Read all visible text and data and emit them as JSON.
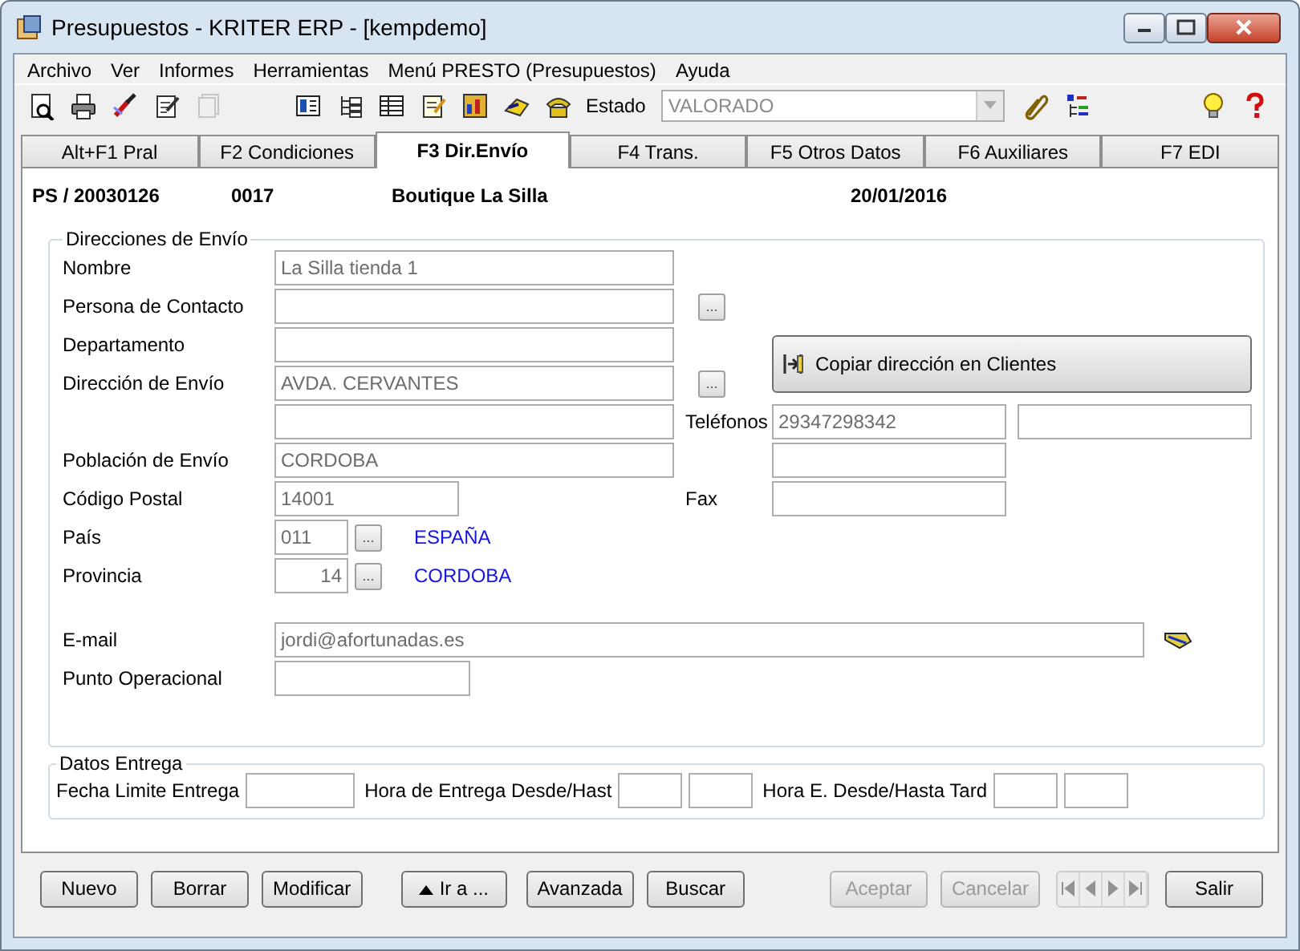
{
  "window": {
    "title": "Presupuestos - KRITER ERP - [kempdemo]"
  },
  "menu": [
    {
      "label": "Archivo"
    },
    {
      "label": "Ver"
    },
    {
      "label": "Informes"
    },
    {
      "label": "Herramientas"
    },
    {
      "label": "Menú PRESTO (Presupuestos)"
    },
    {
      "label": "Ayuda"
    }
  ],
  "toolbar": {
    "tools": [
      {
        "disabled": false
      },
      {
        "disabled": false
      },
      {
        "disabled": false
      },
      {
        "disabled": false
      },
      {
        "disabled": true
      },
      {
        "disabled": false
      },
      {
        "disabled": false
      },
      {
        "disabled": false
      },
      {
        "disabled": false
      },
      {
        "disabled": false
      },
      {
        "disabled": false
      },
      {
        "disabled": false
      }
    ],
    "estado_label": "Estado",
    "estado": {
      "value": "VALORADO",
      "disabled": true
    },
    "tools_after": [
      {
        "disabled": false
      },
      {
        "disabled": false
      },
      {
        "disabled": false
      },
      {
        "disabled": false
      }
    ]
  },
  "tabs": [
    {
      "label": "Alt+F1 Pral",
      "selected": false
    },
    {
      "label": "F2 Condiciones",
      "selected": false
    },
    {
      "label": "F3 Dir.Envío",
      "selected": true
    },
    {
      "label": "F4 Trans.",
      "selected": false
    },
    {
      "label": "F5 Otros Datos",
      "selected": false
    },
    {
      "label": "F6 Auxiliares",
      "selected": false
    },
    {
      "label": "F7 EDI",
      "selected": false
    }
  ],
  "header": {
    "document": "PS / 20030126",
    "code": "0017",
    "customer": "Boutique La Silla",
    "date": "20/01/2016"
  },
  "shipping": {
    "title": "Direcciones de Envío",
    "fields": [
      {
        "kind": "text",
        "label": "Nombre",
        "value": "La Silla tienda 1"
      },
      {
        "kind": "text",
        "label": "Persona de Contacto",
        "lookup": "..."
      },
      {
        "kind": "text",
        "label": "Departamento"
      },
      {
        "kind": "text",
        "label": "Dirección de Envío",
        "value": "AVDA. CERVANTES",
        "lookup": "..."
      },
      {
        "kind": "text"
      },
      {
        "kind": "text",
        "label": "Población de Envío",
        "value": "CORDOBA"
      },
      {
        "kind": "short",
        "label": "Código Postal",
        "value": "14001"
      },
      {
        "kind": "code",
        "label": "País",
        "value": "011",
        "lookup": "...",
        "lookup_name": "ESPAÑA"
      },
      {
        "kind": "number",
        "label": "Provincia",
        "value": "14",
        "lookup": "...",
        "lookup_name": "CORDOBA"
      }
    ],
    "copy_button": "Copiar dirección en Clientes",
    "phones_label": "Teléfonos",
    "phones": [
      {
        "kind": "phone",
        "value": "29347298342"
      },
      {
        "kind": "phone"
      },
      {
        "kind": "phone"
      }
    ],
    "fax_label": "Fax",
    "email": {
      "label": "E-mail",
      "value": "jordi@afortunadas.es"
    },
    "operational_point": {
      "label": "Punto Operacional"
    }
  },
  "delivery": {
    "title": "Datos Entrega",
    "items": [
      {
        "label": "Fecha Limite Entrega",
        "fields": [
          {
            "kind": "date"
          }
        ]
      },
      {
        "label": "Hora de Entrega Desde/Hast",
        "fields": [
          {
            "kind": "time"
          },
          {
            "kind": "time"
          }
        ]
      },
      {
        "label": "Hora E. Desde/Hasta Tard",
        "fields": [
          {
            "kind": "time"
          },
          {
            "kind": "time"
          }
        ]
      }
    ]
  },
  "left_groups": [
    [
      {
        "kind": "button",
        "label": "Nuevo",
        "disabled": false
      },
      {
        "kind": "button",
        "label": "Borrar",
        "disabled": false
      },
      {
        "kind": "button",
        "label": "Modificar",
        "disabled": false
      }
    ],
    [
      {
        "kind": "goto",
        "label": "Ir a ...",
        "disabled": false
      }
    ],
    [
      {
        "kind": "button",
        "label": "Avanzada",
        "disabled": false
      },
      {
        "kind": "button",
        "label": "Buscar",
        "disabled": false
      }
    ]
  ],
  "right_groups": [
    [
      {
        "kind": "button",
        "label": "Aceptar",
        "disabled": true
      },
      {
        "kind": "button",
        "label": "Cancelar",
        "disabled": true
      }
    ],
    [
      {
        "kind": "nav",
        "disabled": true
      }
    ],
    [
      {
        "kind": "button",
        "label": "Salir",
        "disabled": false
      }
    ]
  ]
}
